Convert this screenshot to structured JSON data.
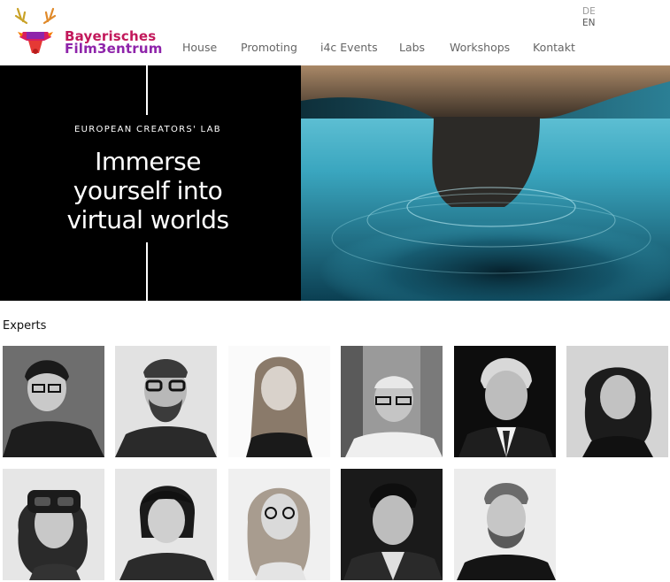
{
  "brand": {
    "line1": "Bayerisches",
    "line2": "Film3entrum",
    "accent": "#c2185b",
    "accent2": "#8e24aa"
  },
  "nav": {
    "items": [
      "House",
      "Promoting",
      "i4c Events",
      "Labs",
      "Workshops",
      "Kontakt"
    ]
  },
  "lang": {
    "de": "DE",
    "en": "EN"
  },
  "hero": {
    "kicker": "EUROPEAN CREATORS' LAB",
    "line1": "Immerse",
    "line2": "yourself into",
    "line3": "virtual worlds"
  },
  "experts": {
    "title": "Experts",
    "rows": [
      [
        "expert-photo",
        "expert-photo",
        "expert-photo",
        "expert-photo",
        "expert-photo",
        "expert-photo"
      ],
      [
        "expert-photo",
        "expert-photo",
        "expert-photo",
        "expert-photo",
        "expert-photo"
      ]
    ]
  }
}
